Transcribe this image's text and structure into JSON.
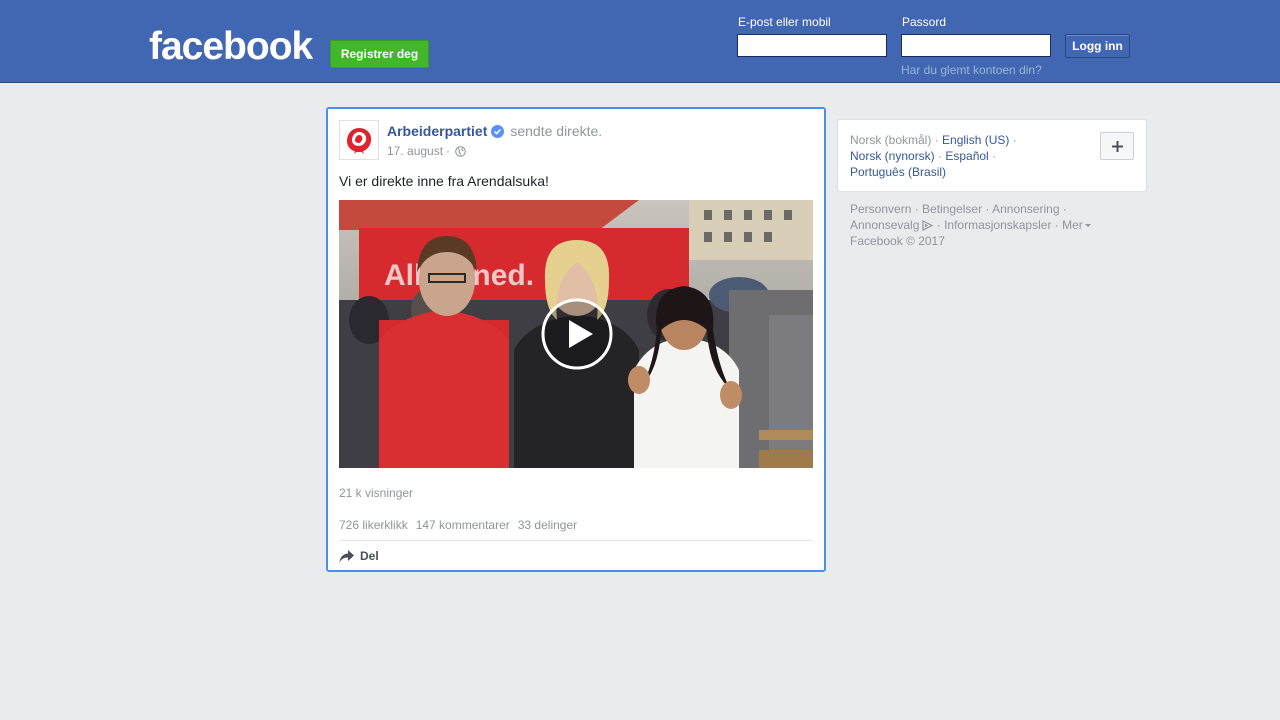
{
  "header": {
    "logo_text": "facebook",
    "register_label": "Registrer deg",
    "email_label": "E-post eller mobil",
    "email_value": "",
    "password_label": "Passord",
    "password_value": "",
    "login_label": "Logg inn",
    "forgot_label": "Har du glemt kontoen din?"
  },
  "post": {
    "author": "Arbeiderpartiet",
    "action": "sendte direkte.",
    "date": "17. august",
    "date_separator": "·",
    "text": "Vi er direkte inne fra Arendalsuka!",
    "views": "21 k visninger",
    "likes": "726 likerklikk",
    "comments": "147 kommentarer",
    "shares": "33 delinger",
    "share_label": "Del"
  },
  "languages": {
    "current": "Norsk (bokmål)",
    "options": [
      "English (US)",
      "Norsk (nynorsk)",
      "Español",
      "Português (Brasil)"
    ]
  },
  "footer": {
    "links": [
      "Personvern",
      "Betingelser",
      "Annonsering",
      "Annonsevalg",
      "Informasjonskapsler",
      "Mer"
    ],
    "copyright": "Facebook © 2017"
  },
  "colors": {
    "brand_blue": "#4267b2",
    "register_green": "#42b72a",
    "link_blue": "#365899",
    "focus_border": "#4a90e2"
  }
}
